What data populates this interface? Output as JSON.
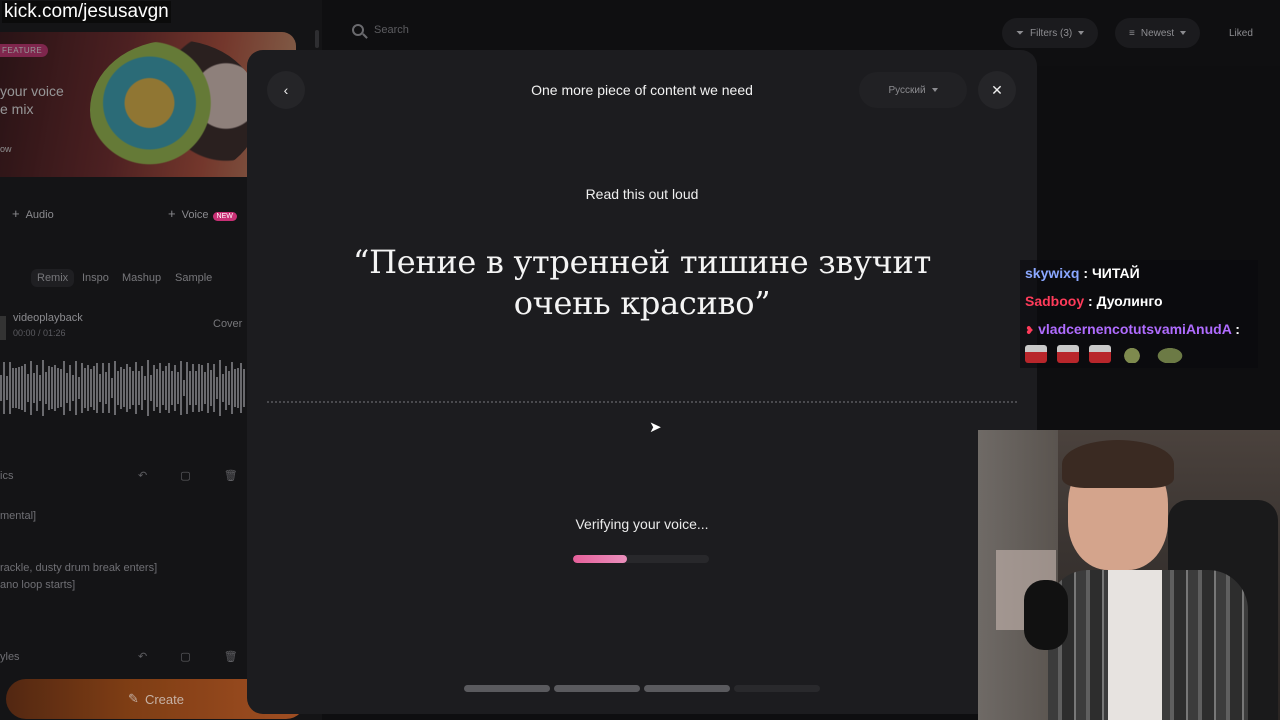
{
  "background_app": {
    "feature": {
      "badge": "FEATURE",
      "title_line1": "your voice",
      "title_line2": "e mix",
      "cta": "ow"
    },
    "tools": {
      "audio": "Audio",
      "voice": "Voice",
      "new_badge": "NEW"
    },
    "chips": [
      "Remix",
      "Inspo",
      "Mashup",
      "Sample"
    ],
    "track": {
      "name": "videoplayback",
      "time": "00:00 / 01:26",
      "action": "Cover"
    },
    "lyrics_header": "ics",
    "lyrics": [
      "mental]",
      "rackle, dusty drum break enters]",
      "ano loop starts]"
    ],
    "styles_header": "yles",
    "create_label": "Create",
    "search_placeholder": "Search",
    "filters_label": "Filters (3)",
    "sort_label": "Newest",
    "liked_label": "Liked"
  },
  "overlay": {
    "kick_url": "kick.com/jesusavgn",
    "chat": [
      {
        "user": "skywixq",
        "color": "#8aa7ff",
        "message": "ЧИТАЙ"
      },
      {
        "user": "Sadbooy",
        "color": "#ff3b5a",
        "message": "Дуолинго"
      },
      {
        "user": "vladcernencotutsvamiAnudA",
        "color": "#b06cff",
        "message": ""
      }
    ]
  },
  "modal": {
    "title": "One more piece of content we need",
    "language": "Русский",
    "instruction": "Read this out loud",
    "quote": "“Пение в утренней тишине звучит очень красиво”",
    "status": "Verifying your voice...",
    "progress": 0.4,
    "steps_total": 4,
    "steps_completed": 3,
    "colors": {
      "accent": "#e5609a",
      "modal_bg": "#1c1c1f"
    }
  }
}
